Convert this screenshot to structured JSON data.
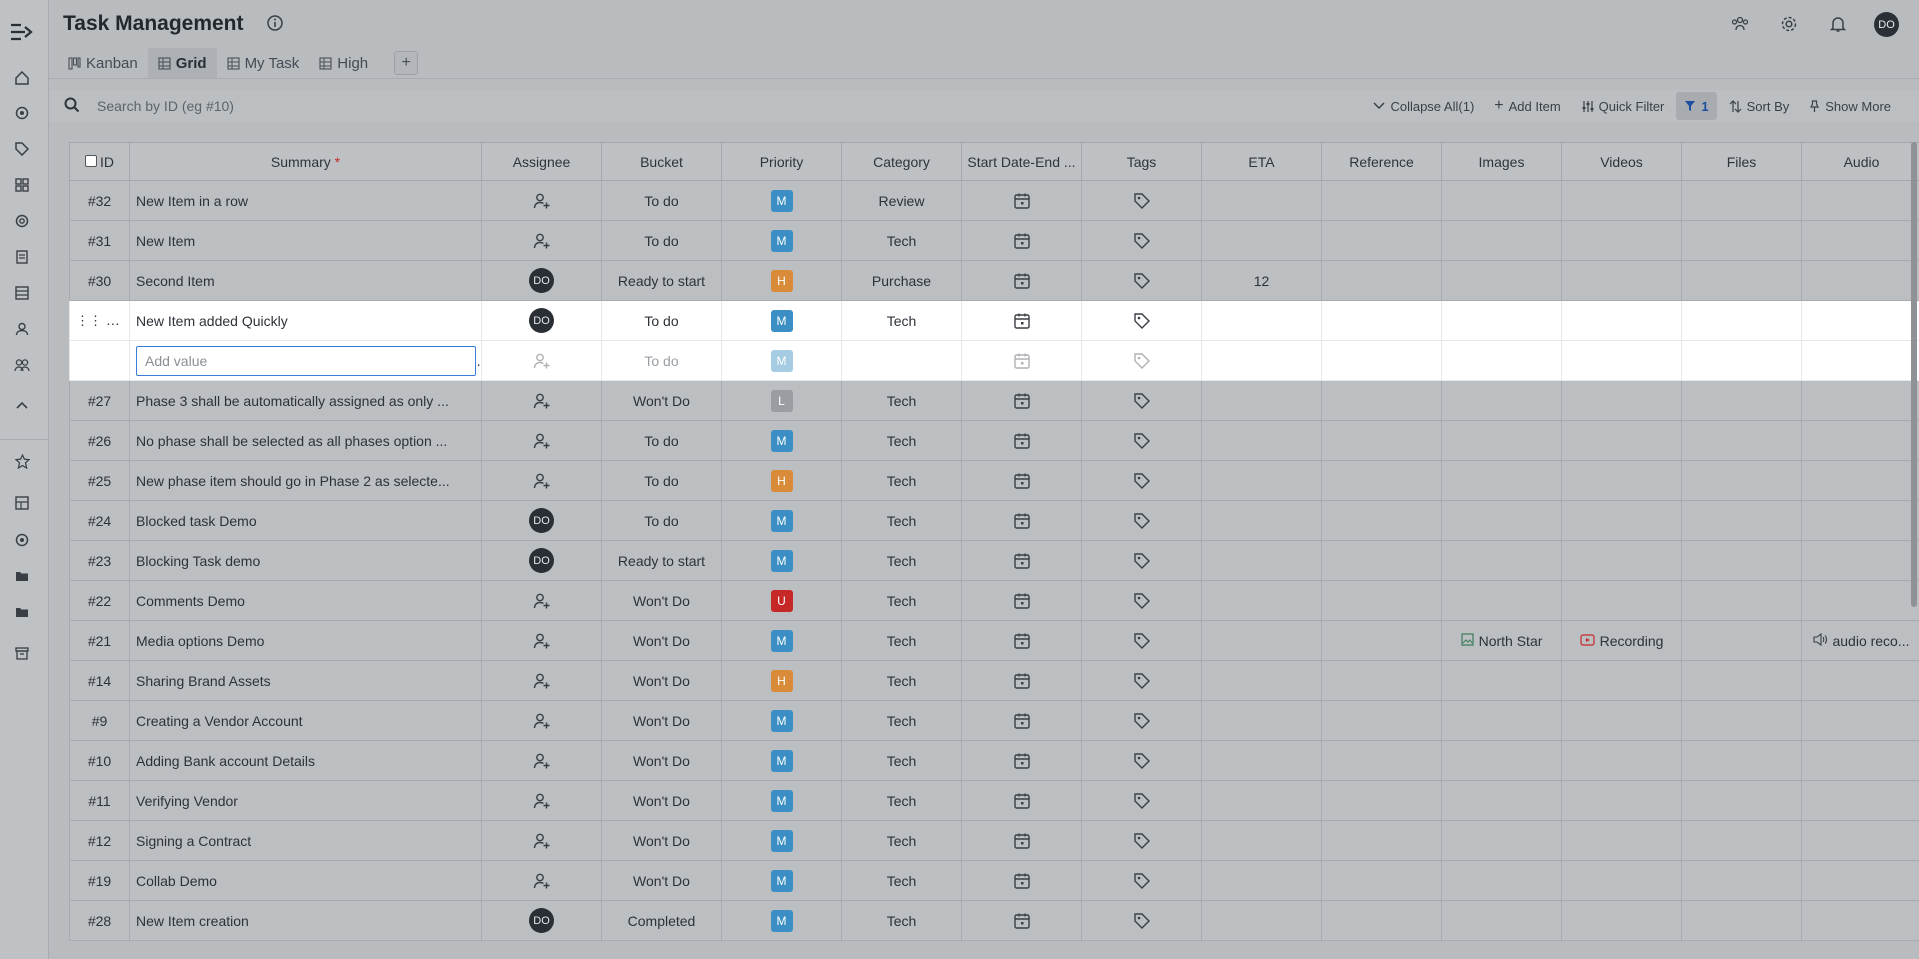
{
  "app": {
    "title": "Task Management"
  },
  "user": {
    "initials": "DO"
  },
  "tabs": [
    {
      "label": "Kanban",
      "icon": "kanban-icon",
      "active": false
    },
    {
      "label": "Grid",
      "icon": "grid-icon",
      "active": true
    },
    {
      "label": "My Task",
      "icon": "grid-icon",
      "active": false
    },
    {
      "label": "High",
      "icon": "grid-icon",
      "active": false
    }
  ],
  "search": {
    "placeholder": "Search by ID (eg #10)"
  },
  "toolbar": {
    "collapse_all": "Collapse All(1)",
    "add_item": "Add Item",
    "quick_filter": "Quick Filter",
    "filter_count": "1",
    "sort_by": "Sort By",
    "show_more": "Show More"
  },
  "columns": [
    "ID",
    "Summary",
    "Assignee",
    "Bucket",
    "Priority",
    "Category",
    "Start Date-End ...",
    "Tags",
    "ETA",
    "Reference",
    "Images",
    "Videos",
    "Files",
    "Audio"
  ],
  "required_mark": "*",
  "new_row": {
    "placeholder": "Add value",
    "bucket": "To do",
    "priority": "M"
  },
  "rows": [
    {
      "id": "#32",
      "summary": "New Item in a row",
      "assignee": "",
      "bucket": "To do",
      "priority": "M",
      "category": "Review",
      "eta": ""
    },
    {
      "id": "#31",
      "summary": "New Item",
      "assignee": "",
      "bucket": "To do",
      "priority": "M",
      "category": "Tech",
      "eta": ""
    },
    {
      "id": "#30",
      "summary": "Second Item",
      "assignee": "DO",
      "bucket": "Ready to start",
      "priority": "H",
      "category": "Purchase",
      "eta": "12"
    },
    {
      "id": "",
      "summary": "New Item added Quickly",
      "assignee": "DO",
      "bucket": "To do",
      "priority": "M",
      "category": "Tech",
      "eta": "",
      "highlight": true
    },
    {
      "id": "#27",
      "summary": "Phase 3 shall be automatically assigned as only ...",
      "assignee": "",
      "bucket": "Won't Do",
      "priority": "L",
      "category": "Tech",
      "eta": ""
    },
    {
      "id": "#26",
      "summary": "No phase shall be selected as all phases option ...",
      "assignee": "",
      "bucket": "To do",
      "priority": "M",
      "category": "Tech",
      "eta": ""
    },
    {
      "id": "#25",
      "summary": "New phase item should go in Phase 2 as selecte...",
      "assignee": "",
      "bucket": "To do",
      "priority": "H",
      "category": "Tech",
      "eta": ""
    },
    {
      "id": "#24",
      "summary": "Blocked task Demo",
      "assignee": "DO",
      "bucket": "To do",
      "priority": "M",
      "category": "Tech",
      "eta": ""
    },
    {
      "id": "#23",
      "summary": "Blocking Task demo",
      "assignee": "DO",
      "bucket": "Ready to start",
      "priority": "M",
      "category": "Tech",
      "eta": ""
    },
    {
      "id": "#22",
      "summary": "Comments Demo",
      "assignee": "",
      "bucket": "Won't Do",
      "priority": "U",
      "category": "Tech",
      "eta": ""
    },
    {
      "id": "#21",
      "summary": "Media options Demo",
      "assignee": "",
      "bucket": "Won't Do",
      "priority": "M",
      "category": "Tech",
      "eta": "",
      "image": "North Star",
      "video": "Recording",
      "audio": "audio reco..."
    },
    {
      "id": "#14",
      "summary": "Sharing Brand Assets",
      "assignee": "",
      "bucket": "Won't Do",
      "priority": "H",
      "category": "Tech",
      "eta": ""
    },
    {
      "id": "#9",
      "summary": "Creating a Vendor Account",
      "assignee": "",
      "bucket": "Won't Do",
      "priority": "M",
      "category": "Tech",
      "eta": ""
    },
    {
      "id": "#10",
      "summary": "Adding Bank account Details",
      "assignee": "",
      "bucket": "Won't Do",
      "priority": "M",
      "category": "Tech",
      "eta": ""
    },
    {
      "id": "#11",
      "summary": "Verifying Vendor",
      "assignee": "",
      "bucket": "Won't Do",
      "priority": "M",
      "category": "Tech",
      "eta": ""
    },
    {
      "id": "#12",
      "summary": "Signing a Contract",
      "assignee": "",
      "bucket": "Won't Do",
      "priority": "M",
      "category": "Tech",
      "eta": ""
    },
    {
      "id": "#19",
      "summary": "Collab Demo",
      "assignee": "",
      "bucket": "Won't Do",
      "priority": "M",
      "category": "Tech",
      "eta": ""
    },
    {
      "id": "#28",
      "summary": "New Item creation",
      "assignee": "DO",
      "bucket": "Completed",
      "priority": "M",
      "category": "Tech",
      "eta": ""
    }
  ],
  "colors": {
    "priority_M": "#3b8fc4",
    "priority_H": "#d98b3a",
    "priority_L": "#9a9ea3",
    "priority_U": "#c62828",
    "accent": "#1d4fa0"
  }
}
